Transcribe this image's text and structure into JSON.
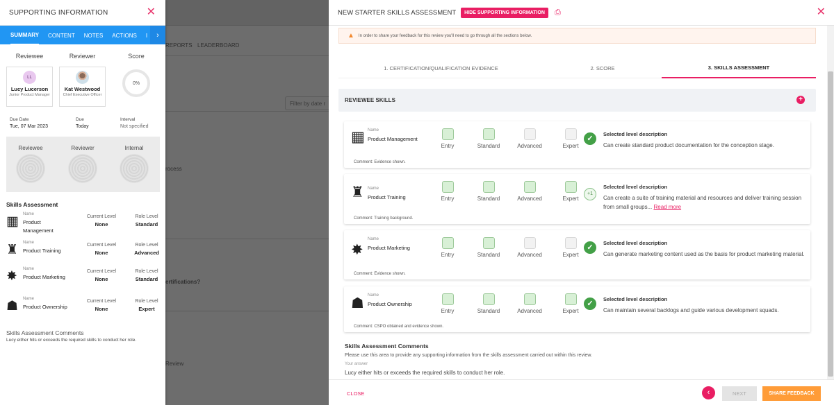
{
  "background": {
    "reports": "REPORTS",
    "leaderboard": "LEADERBOARD",
    "filter": "Filter by date r",
    "process": "rocess",
    "certifications": "ertifications?",
    "review": "Review"
  },
  "left_panel": {
    "title": "SUPPORTING INFORMATION",
    "tabs": [
      "SUMMARY",
      "CONTENT",
      "NOTES",
      "ACTIONS",
      "I"
    ],
    "reviewee_label": "Reviewee",
    "reviewer_label": "Reviewer",
    "score_label": "Score",
    "reviewee": {
      "initials": "LL",
      "name": "Lucy Lucerson",
      "role": "Junior Product Manager"
    },
    "reviewer": {
      "name": "Kat Westwood",
      "role": "Chief Executive Officer"
    },
    "score": "0%",
    "due_date_label": "Due Date",
    "due_date": "Tue, 07 Mar 2023",
    "due_label": "Due",
    "due": "Today",
    "interval_label": "Interval",
    "interval": "Not specified",
    "graph_labels": [
      "Reviewee",
      "Reviewer",
      "Internal"
    ],
    "skills_title": "Skills Assessment",
    "name_label": "Name",
    "current_level_label": "Current Level",
    "role_level_label": "Role Level",
    "skills": [
      {
        "icon": "boxes-icon",
        "name": "Product Management",
        "current": "None",
        "role": "Standard"
      },
      {
        "icon": "training-icon",
        "name": "Product Training",
        "current": "None",
        "role": "Advanced"
      },
      {
        "icon": "marketing-icon",
        "name": "Product Marketing",
        "current": "None",
        "role": "Standard"
      },
      {
        "icon": "ownership-icon",
        "name": "Product Ownership",
        "current": "None",
        "role": "Expert"
      }
    ],
    "comments_title": "Skills Assessment Comments",
    "comments_text": "Lucy either hits or exceeds the required skills to conduct her role."
  },
  "dialog": {
    "title": "NEW STARTER SKILLS ASSESSMENT",
    "hide_button": "HIDE SUPPORTING INFORMATION",
    "warning": "In order to share your feedback for this review you'll need to go through all the sections below.",
    "steps": [
      "1. CERTIFICATION/QUALIFICATION EVIDENCE",
      "2. SCORE",
      "3. SKILLS ASSESSMENT"
    ],
    "reviewee_skills": "REVIEWEE SKILLS",
    "levels": [
      "Entry",
      "Standard",
      "Advanced",
      "Expert"
    ],
    "selected_level_label": "Selected level description",
    "skills": [
      {
        "name": "Product Management",
        "levels_on": [
          true,
          true,
          false,
          false
        ],
        "badge": "check",
        "badge_text": "✓",
        "desc": "Can create standard product documentation for the conception stage.",
        "read_more": "",
        "comment": "Comment: Evidence shown."
      },
      {
        "name": "Product Training",
        "levels_on": [
          true,
          true,
          true,
          true
        ],
        "badge": "plus",
        "badge_text": "+1",
        "desc": "Can create a suite of training material and resources and deliver training session from small groups...",
        "read_more": "Read more",
        "comment": "Comment: Training background."
      },
      {
        "name": "Product Marketing",
        "levels_on": [
          true,
          true,
          false,
          false
        ],
        "badge": "check",
        "badge_text": "✓",
        "desc": "Can generate marketing content used as the basis for product marketing material.",
        "read_more": "",
        "comment": "Comment: Evidence shown."
      },
      {
        "name": "Product Ownership",
        "levels_on": [
          true,
          true,
          true,
          true
        ],
        "badge": "check",
        "badge_text": "✓",
        "desc": "Can maintain several backlogs and guide various development squads.",
        "read_more": "",
        "comment": "Comment: CSPO obtained and evidence shown."
      }
    ],
    "comments_title": "Skills Assessment Comments",
    "comments_help": "Please use this area to provide any supporting information from the skills assessment carried out within this review.",
    "your_answer_label": "Your answer",
    "answer": "Lucy either hits or exceeds the required skills to conduct her role.",
    "close": "CLOSE",
    "next": "NEXT",
    "share": "SHARE FEEDBACK"
  },
  "colors": {
    "accent": "#e91e63",
    "tab_blue": "#2196f3",
    "share_orange": "#ff9c38",
    "check_green": "#43a047"
  }
}
